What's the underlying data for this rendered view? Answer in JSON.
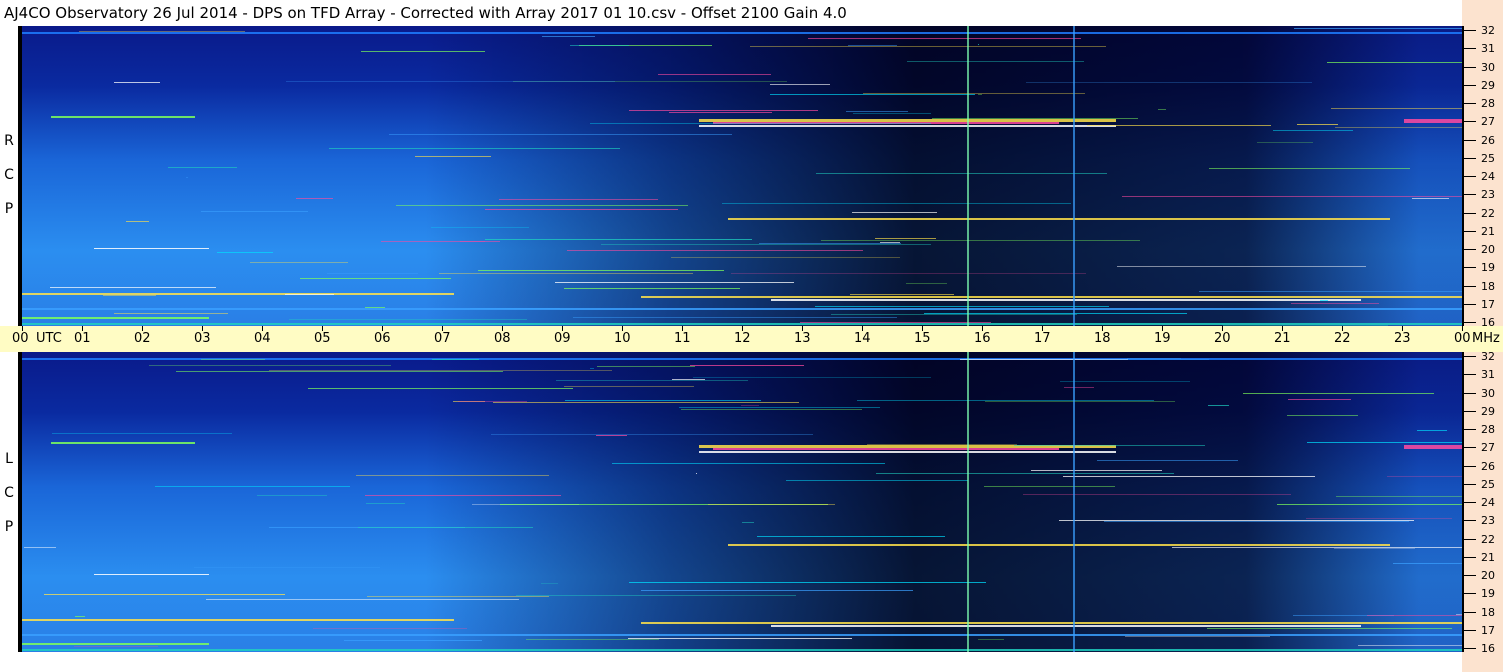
{
  "title": "AJ4CO Observatory  26 Jul 2014  -  DPS on TFD Array  -  Corrected with Array 2017 01 10.csv  -  Offset 2100  Gain 4.0",
  "panels": [
    {
      "polarization": [
        "R",
        "C",
        "P"
      ]
    },
    {
      "polarization": [
        "L",
        "C",
        "P"
      ]
    }
  ],
  "time_axis": {
    "hours": [
      "00",
      "01",
      "02",
      "03",
      "04",
      "05",
      "06",
      "07",
      "08",
      "09",
      "10",
      "11",
      "12",
      "13",
      "14",
      "15",
      "16",
      "17",
      "18",
      "19",
      "20",
      "21",
      "22",
      "23",
      "00"
    ],
    "start_unit": "UTC",
    "end_unit": "MHz"
  },
  "frequency_axis": {
    "labels": [
      "32",
      "31",
      "30",
      "29",
      "28",
      "27",
      "26",
      "25",
      "24",
      "23",
      "22",
      "21",
      "20",
      "19",
      "18",
      "17",
      "16"
    ]
  },
  "colors": {
    "time_axis_bg": "#fffcc4",
    "freq_axis_bg": "#fce3cf",
    "colormap": "spectrogram-blue-to-white"
  }
}
